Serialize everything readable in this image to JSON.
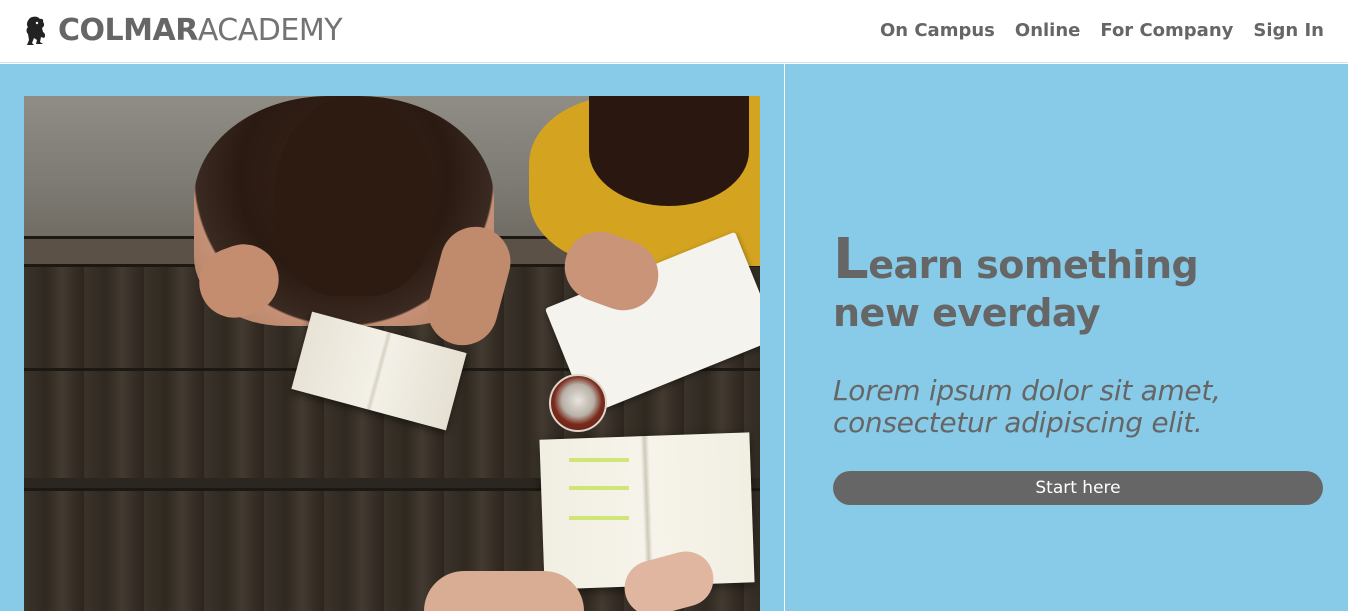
{
  "header": {
    "logo_icon": "lion-crest-icon",
    "logo_strong": "COLMAR",
    "logo_light": "ACADEMY",
    "nav": [
      {
        "label": "On Campus"
      },
      {
        "label": "Online"
      },
      {
        "label": "For Company"
      },
      {
        "label": "Sign In"
      }
    ]
  },
  "hero": {
    "image": "students-studying-at-table-photo",
    "title_first_letter": "L",
    "title_rest_line1": "earn something",
    "title_line2": "new everday",
    "subtitle": "Lorem ipsum dolor sit amet, consectetur adipiscing elit.",
    "button_label": "Start here"
  },
  "colors": {
    "header_bg": "#ffffff",
    "hero_bg": "#87cbe8",
    "text": "#666666",
    "button_bg": "#666666",
    "button_text": "#ffffff"
  }
}
